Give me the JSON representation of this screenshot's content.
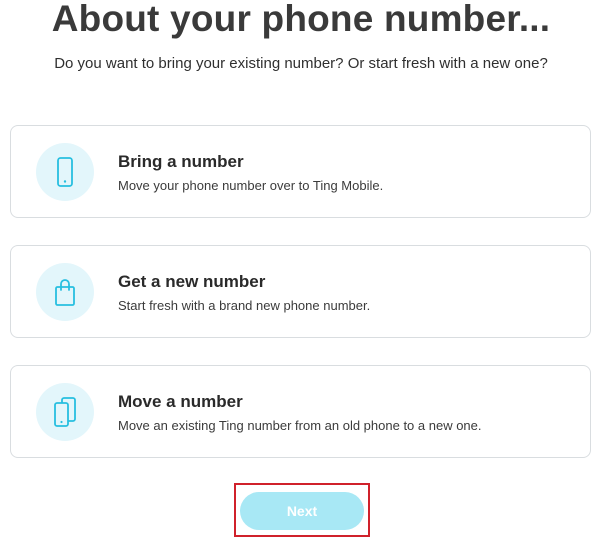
{
  "header": {
    "title": "About your phone number...",
    "subtitle": "Do you want to bring your existing number? Or start fresh with a new one?"
  },
  "options": [
    {
      "icon": "smartphone-icon",
      "title": "Bring a number",
      "description": "Move your phone number over to Ting Mobile."
    },
    {
      "icon": "shopping-bag-icon",
      "title": "Get a new number",
      "description": "Start fresh with a brand new phone number."
    },
    {
      "icon": "phone-transfer-icon",
      "title": "Move a number",
      "description": "Move an existing Ting number from an old phone to a new one."
    }
  ],
  "footer": {
    "next_label": "Next"
  },
  "colors": {
    "icon_accent": "#27bfe0",
    "icon_background": "#e3f6fb",
    "next_button_disabled": "#a8e8f5",
    "highlight_border": "#d0212b"
  }
}
